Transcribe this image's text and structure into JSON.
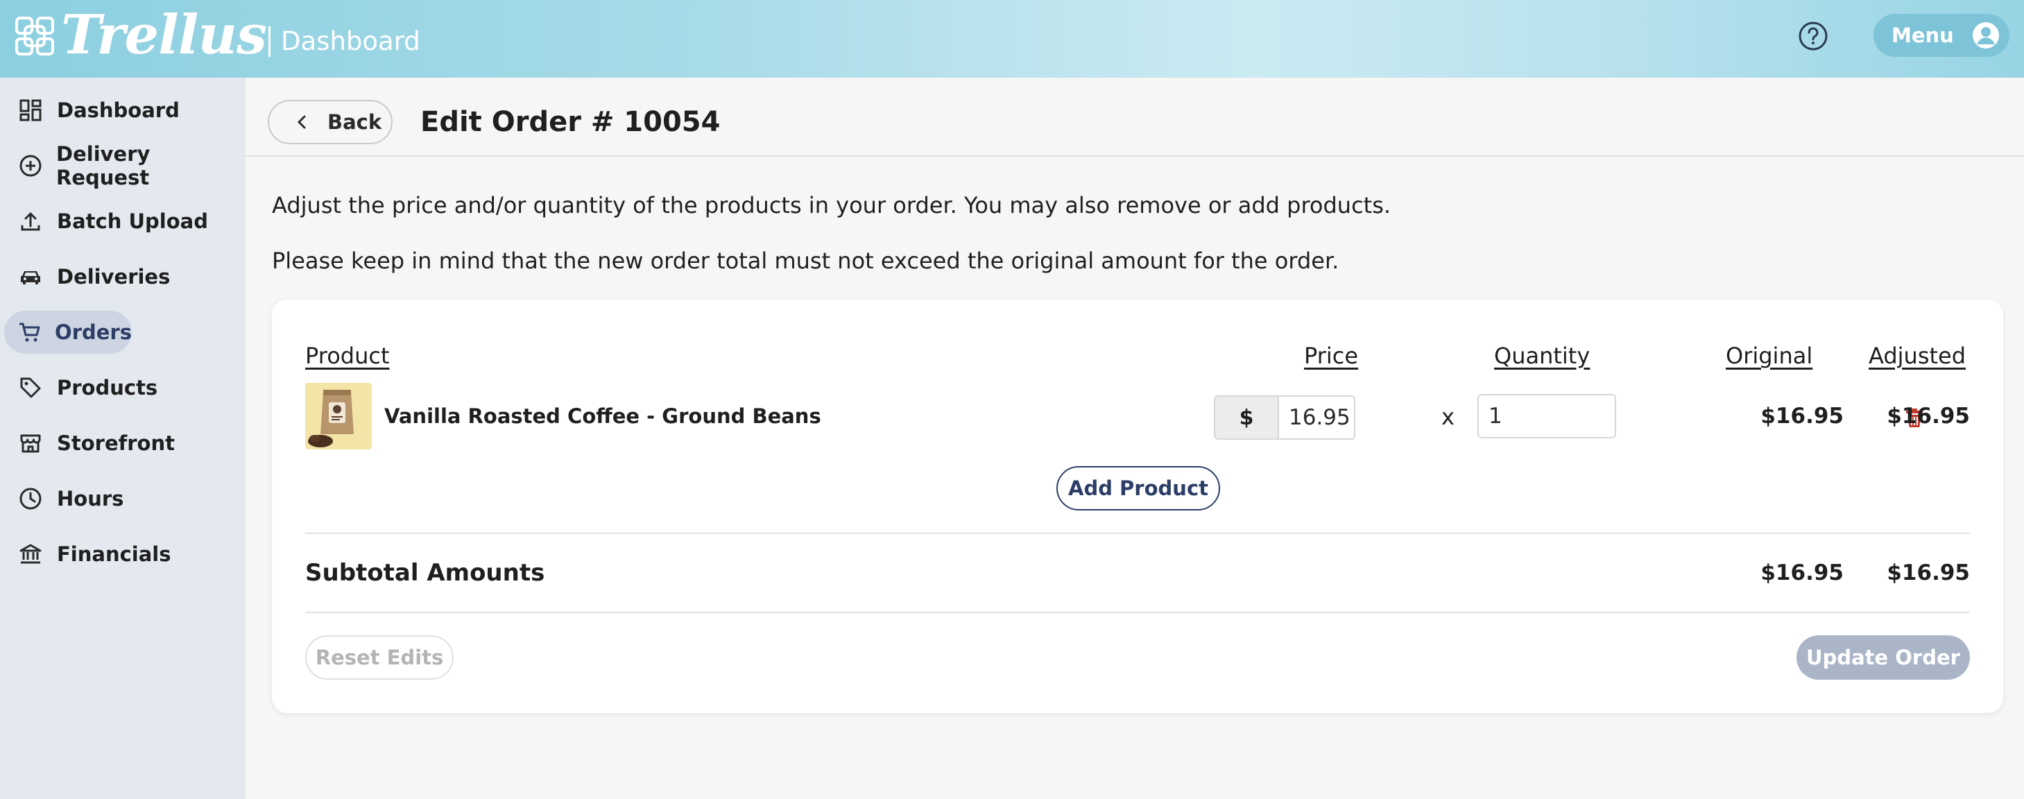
{
  "header": {
    "logo_text": "Trellus",
    "section": "Dashboard",
    "menu_label": "Menu"
  },
  "sidebar": {
    "items": [
      {
        "label": "Dashboard",
        "icon": "dashboard-icon"
      },
      {
        "label": "Delivery Request",
        "icon": "plus-circle-icon"
      },
      {
        "label": "Batch Upload",
        "icon": "upload-icon"
      },
      {
        "label": "Deliveries",
        "icon": "car-icon"
      },
      {
        "label": "Orders",
        "icon": "cart-icon",
        "active": true
      },
      {
        "label": "Products",
        "icon": "tag-icon"
      },
      {
        "label": "Storefront",
        "icon": "storefront-icon"
      },
      {
        "label": "Hours",
        "icon": "clock-icon"
      },
      {
        "label": "Financials",
        "icon": "bank-icon"
      }
    ]
  },
  "topbar": {
    "back_label": "Back",
    "title": "Edit Order # 10054"
  },
  "intro": {
    "line1": "Adjust the price and/or quantity of the products in your order. You may also remove or add products.",
    "line2": "Please keep in mind that the new order total must not exceed the original amount for the order."
  },
  "table": {
    "headers": {
      "product": "Product",
      "price": "Price",
      "quantity": "Quantity",
      "original": "Original",
      "adjusted": "Adjusted"
    },
    "rows": [
      {
        "name": "Vanilla Roasted Coffee - Ground Beans",
        "currency": "$",
        "price": "16.95",
        "times": "x",
        "quantity": "1",
        "original": "$16.95",
        "adjusted": "$16.95"
      }
    ],
    "add_label": "Add Product"
  },
  "subtotal": {
    "label": "Subtotal Amounts",
    "original": "$16.95",
    "adjusted": "$16.95"
  },
  "actions": {
    "reset_label": "Reset Edits",
    "update_label": "Update Order"
  },
  "colors": {
    "accent": "#2c3e66",
    "sidebar_bg": "#e4e9f0",
    "delete": "#c0392b",
    "disabled_button": "#aab5c8"
  }
}
